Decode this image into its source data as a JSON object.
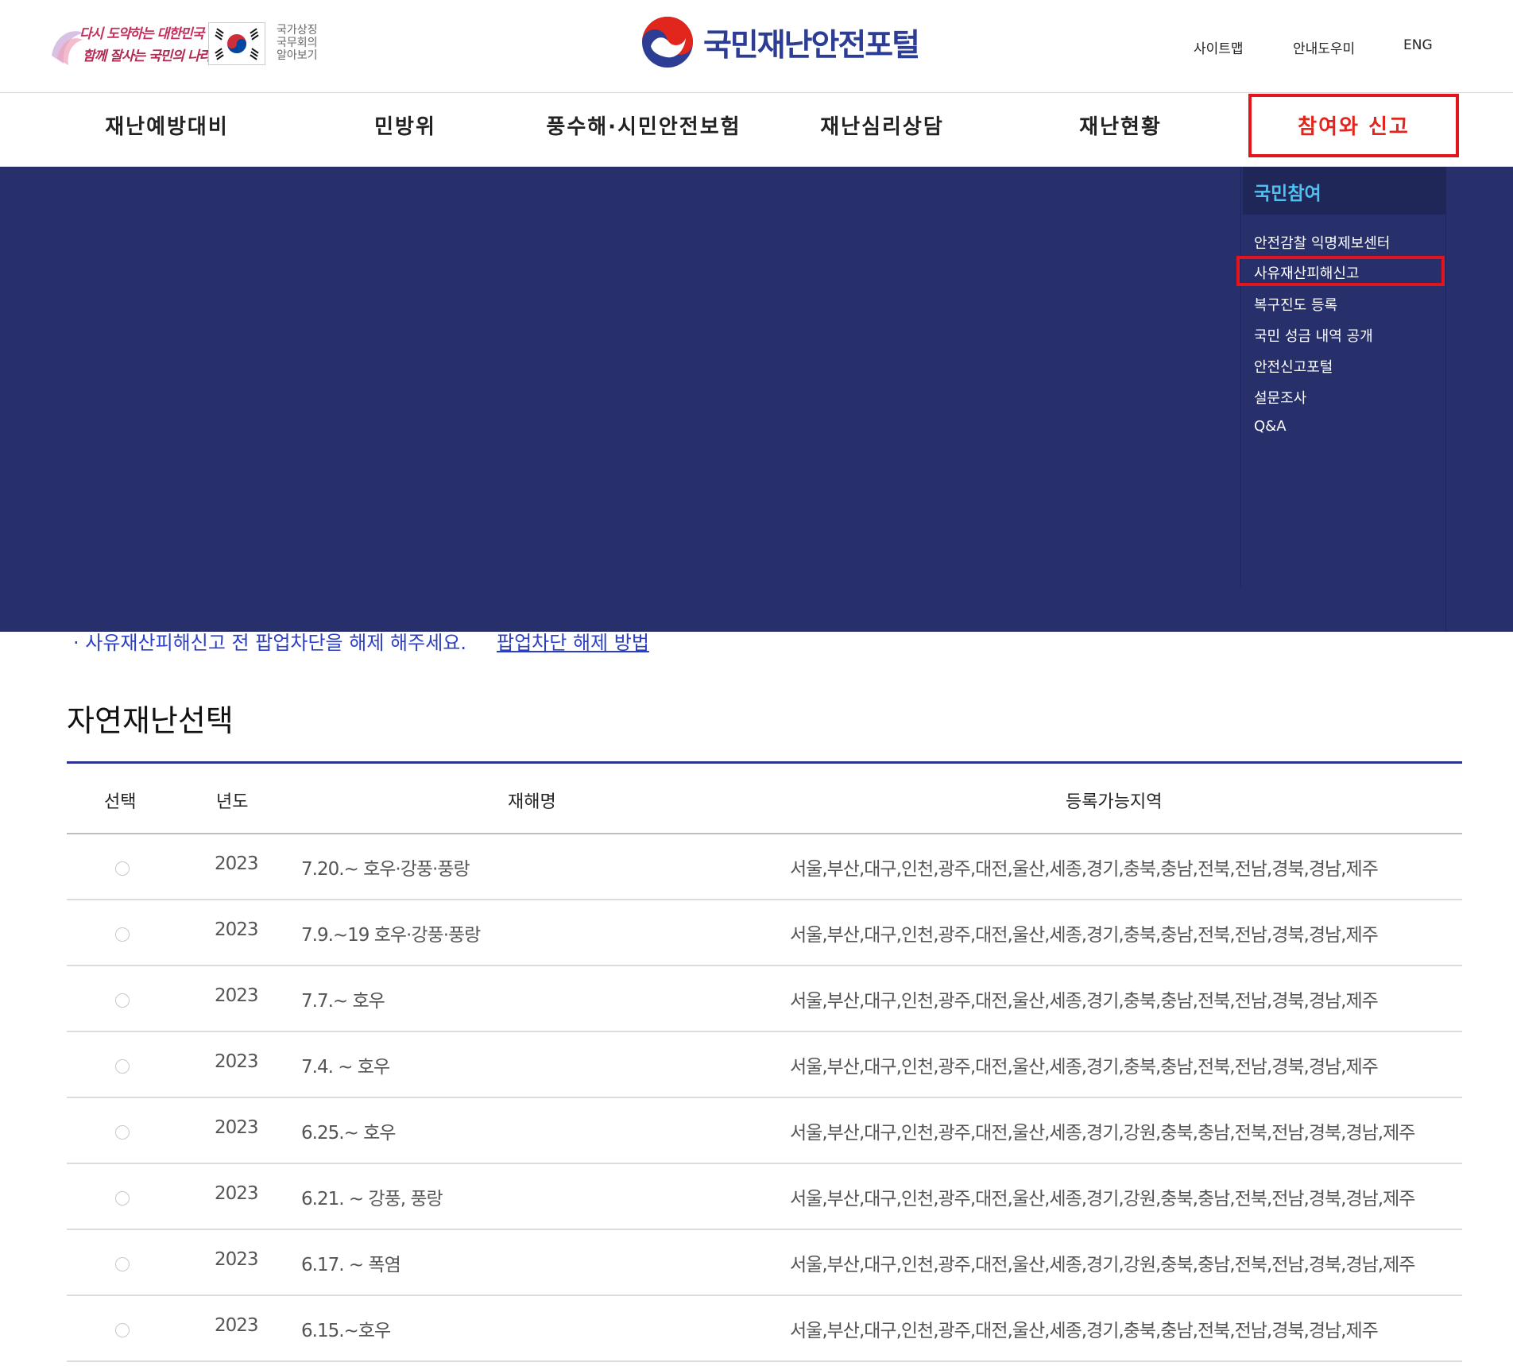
{
  "header": {
    "promo_line1": "다시 도약하는 대한민국",
    "promo_line2": "함께 잘사는 국민의 나라",
    "cabinet_text": [
      "국가상징",
      "국무회의",
      "알아보기"
    ],
    "portal_title": "국민재난안전포털",
    "util_links": {
      "sitemap": "사이트맵",
      "guide": "안내도우미",
      "eng": "ENG"
    },
    "brand_color": "#2c3d93"
  },
  "gnb": {
    "items": [
      "재난예방대비",
      "민방위",
      "풍수해·시민안전보험",
      "재난심리상담",
      "재난현황",
      "참여와 신고"
    ],
    "active_index": 5
  },
  "dropdown": {
    "section_title": "국민참여",
    "links": [
      "안전감찰 익명제보센터",
      "사유재산피해신고",
      "복구진도 등록",
      "국민 성금 내역 공개",
      "안전신고포털",
      "설문조사",
      "Q&A"
    ],
    "highlighted_index": 1,
    "bg_color": "#27306b"
  },
  "notice": {
    "text": "· 사유재산피해신고 전 팝업차단을 해제 해주세요.",
    "link": "팝업차단 해제 방법"
  },
  "section_title": "자연재난선택",
  "table": {
    "headers": [
      "선택",
      "년도",
      "재해명",
      "등록가능지역"
    ],
    "rows": [
      {
        "year": "2023",
        "name": "7.20.~ 호우·강풍·풍랑",
        "region": "서울,부산,대구,인천,광주,대전,울산,세종,경기,충북,충남,전북,전남,경북,경남,제주"
      },
      {
        "year": "2023",
        "name": "7.9.~19 호우·강풍·풍랑",
        "region": "서울,부산,대구,인천,광주,대전,울산,세종,경기,충북,충남,전북,전남,경북,경남,제주"
      },
      {
        "year": "2023",
        "name": "7.7.~ 호우",
        "region": "서울,부산,대구,인천,광주,대전,울산,세종,경기,충북,충남,전북,전남,경북,경남,제주"
      },
      {
        "year": "2023",
        "name": "7.4. ~ 호우",
        "region": "서울,부산,대구,인천,광주,대전,울산,세종,경기,충북,충남,전북,전남,경북,경남,제주"
      },
      {
        "year": "2023",
        "name": "6.25.~ 호우",
        "region": "서울,부산,대구,인천,광주,대전,울산,세종,경기,강원,충북,충남,전북,전남,경북,경남,제주"
      },
      {
        "year": "2023",
        "name": "6.21. ~ 강풍, 풍랑",
        "region": "서울,부산,대구,인천,광주,대전,울산,세종,경기,강원,충북,충남,전북,전남,경북,경남,제주"
      },
      {
        "year": "2023",
        "name": "6.17. ~ 폭염",
        "region": "서울,부산,대구,인천,광주,대전,울산,세종,경기,강원,충북,충남,전북,전남,경북,경남,제주"
      },
      {
        "year": "2023",
        "name": "6.15.~호우",
        "region": "서울,부산,대구,인천,광주,대전,울산,세종,경기,충북,충남,전북,전남,경북,경남,제주"
      }
    ]
  }
}
